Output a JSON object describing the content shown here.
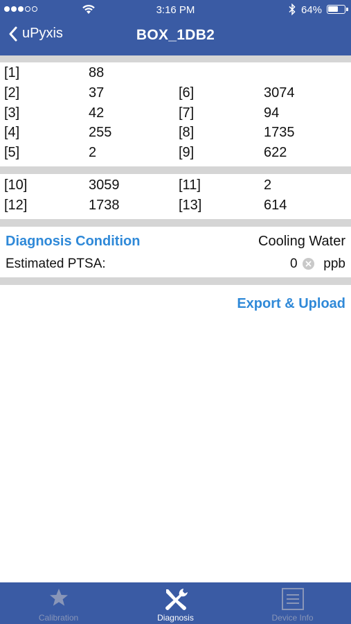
{
  "status_bar": {
    "time": "3:16 PM",
    "battery_text": "64%",
    "battery_level": 0.64,
    "signal_dots_filled": 3,
    "signal_dots_total": 5
  },
  "nav": {
    "back_label": "uPyxis",
    "title": "BOX_1DB2"
  },
  "readings_group1": [
    {
      "left_index": "[1]",
      "left_value": "88",
      "right_index": "",
      "right_value": ""
    },
    {
      "left_index": "[2]",
      "left_value": "37",
      "right_index": "[6]",
      "right_value": "3074"
    },
    {
      "left_index": "[3]",
      "left_value": "42",
      "right_index": "[7]",
      "right_value": "94"
    },
    {
      "left_index": "[4]",
      "left_value": "255",
      "right_index": "[8]",
      "right_value": "1735"
    },
    {
      "left_index": "[5]",
      "left_value": "2",
      "right_index": "[9]",
      "right_value": "622"
    }
  ],
  "readings_group2": [
    {
      "left_index": "[10]",
      "left_value": "3059",
      "right_index": "[11]",
      "right_value": "2"
    },
    {
      "left_index": "[12]",
      "left_value": "1738",
      "right_index": "[13]",
      "right_value": "614"
    }
  ],
  "diagnosis": {
    "condition_label": "Diagnosis Condition",
    "condition_value": "Cooling Water",
    "ptsa_label": "Estimated PTSA:",
    "ptsa_value": "0",
    "ptsa_unit": "ppb"
  },
  "actions": {
    "export_label": "Export & Upload"
  },
  "tabs": [
    {
      "label": "Calibration",
      "icon": "star-icon",
      "active": false
    },
    {
      "label": "Diagnosis",
      "icon": "wrench-screwdriver-icon",
      "active": true
    },
    {
      "label": "Device Info",
      "icon": "document-icon",
      "active": false
    }
  ],
  "colors": {
    "header_bg": "#3a5ba4",
    "accent": "#2f89d8",
    "separator": "#d5d5d5",
    "tab_inactive": "#8996b8"
  }
}
